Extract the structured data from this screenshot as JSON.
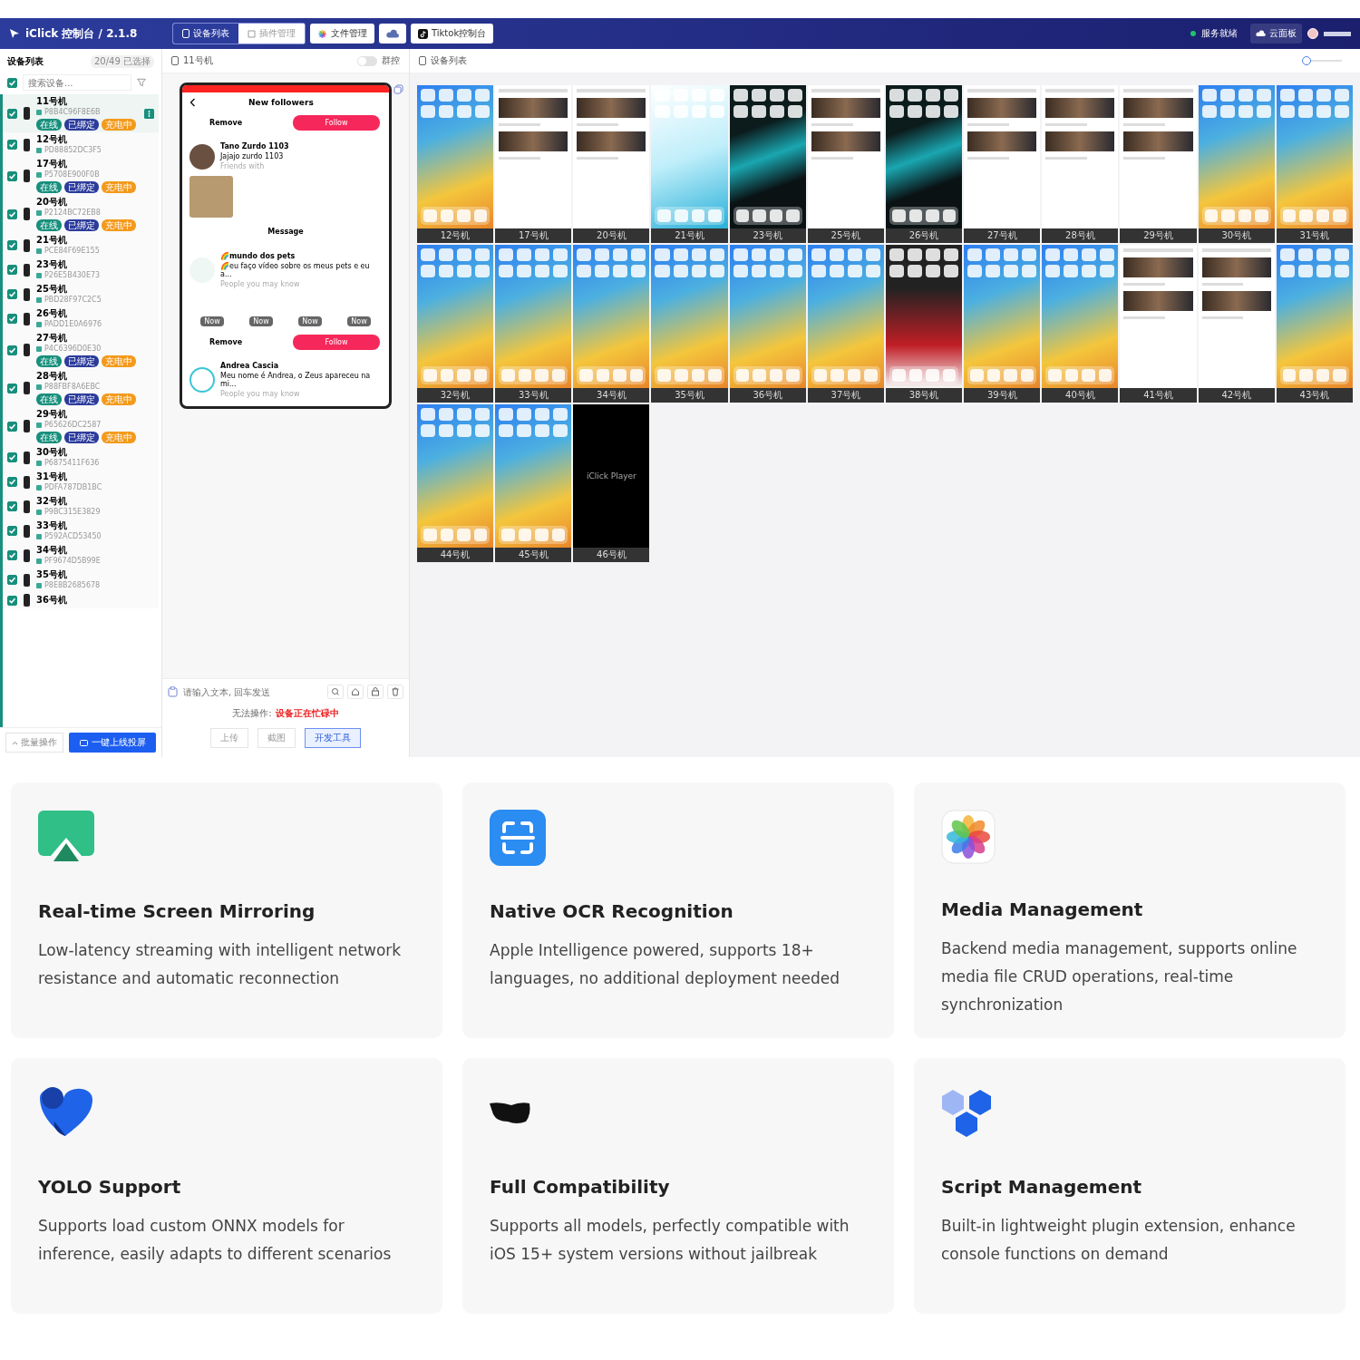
{
  "app": {
    "title": "iClick 控制台 / 2.1.8",
    "nav_tabs": [
      {
        "label": "设备列表",
        "selected": true
      },
      {
        "label": "插件管理",
        "selected": false
      }
    ],
    "nav_buttons": [
      {
        "label": "文件管理"
      },
      {
        "label": "Tiktok控制台"
      }
    ],
    "status": {
      "label": "服务就绪",
      "online": true
    },
    "cloud_button": "云面板"
  },
  "sidebar": {
    "title": "设备列表",
    "count": "20/49 已选择",
    "search_placeholder": "搜索设备...",
    "select_all": true,
    "devices": [
      {
        "name": "11号机",
        "serial": "P8B4C96F8E6B",
        "checked": true,
        "tags": [
          "在线",
          "已绑定",
          "充电中"
        ],
        "active": true
      },
      {
        "name": "12号机",
        "serial": "PD88852DC3F5",
        "checked": true,
        "active": false
      },
      {
        "name": "17号机",
        "serial": "P5708E900F0B",
        "checked": true,
        "tags": [
          "在线",
          "已绑定",
          "充电中"
        ],
        "active": false
      },
      {
        "name": "20号机",
        "serial": "P2124BC72EB8",
        "checked": true,
        "tags": [
          "在线",
          "已绑定",
          "充电中"
        ],
        "active": false
      },
      {
        "name": "21号机",
        "serial": "PCE84F69E155",
        "checked": true,
        "active": false
      },
      {
        "name": "23号机",
        "serial": "P26E5B430E73",
        "checked": true,
        "active": false
      },
      {
        "name": "25号机",
        "serial": "PBD28F97C2C5",
        "checked": true,
        "active": false
      },
      {
        "name": "26号机",
        "serial": "PADD1E0A6976",
        "checked": true,
        "active": false
      },
      {
        "name": "27号机",
        "serial": "P4C6396D0E30",
        "checked": true,
        "tags": [
          "在线",
          "已绑定",
          "充电中"
        ],
        "active": false
      },
      {
        "name": "28号机",
        "serial": "P88FBF8A6EBC",
        "checked": true,
        "tags": [
          "在线",
          "已绑定",
          "充电中"
        ],
        "active": false
      },
      {
        "name": "29号机",
        "serial": "P65626DC2587",
        "checked": true,
        "tags": [
          "在线",
          "已绑定",
          "充电中"
        ],
        "active": false
      },
      {
        "name": "30号机",
        "serial": "P6875411F636",
        "checked": true,
        "active": false
      },
      {
        "name": "31号机",
        "serial": "PDFA787DB1BC",
        "checked": true,
        "active": false
      },
      {
        "name": "32号机",
        "serial": "P9BC315E3829",
        "checked": true,
        "active": false
      },
      {
        "name": "33号机",
        "serial": "P592ACD53450",
        "checked": true,
        "active": false
      },
      {
        "name": "34号机",
        "serial": "PF9674D5B99E",
        "checked": true,
        "active": false
      },
      {
        "name": "35号机",
        "serial": "P8E8B2685678",
        "checked": true,
        "active": false
      },
      {
        "name": "36号机",
        "checked": true,
        "active": false
      }
    ],
    "batch_button": "批量操作",
    "cast_button": "一键上线投屏"
  },
  "control_panel": {
    "device": "11号机",
    "group_control": {
      "label": "群控",
      "on": false
    },
    "phone": {
      "title": "New followers",
      "remove": "Remove",
      "follow": "Follow",
      "users": [
        {
          "name": "Tano Zurdo 1103",
          "handle": "Jajajo zurdo 1103",
          "note": "Friends with"
        },
        {
          "name": "🌈mundo dos pets",
          "handle": "🌈eu faço vídeo sobre os meus pets e eu a...",
          "note": "People you may know"
        }
      ],
      "message": "Message",
      "chips": [
        "Now",
        "Now",
        "Now",
        "Now"
      ],
      "remove2": "Remove",
      "follow2": "Follow",
      "last_user": {
        "name": "Andrea Cascia",
        "handle": "Meu nome é Andrea, o Zeus apareceu na mi...",
        "note": "People you may know"
      }
    },
    "text_placeholder": "请输入文本, 回车发送",
    "notice_label": "无法操作:",
    "notice_value": "设备正在忙碌中",
    "tools": [
      {
        "label": "上传",
        "selected": false
      },
      {
        "label": "截图",
        "selected": false
      },
      {
        "label": "开发工具",
        "selected": true
      }
    ]
  },
  "grid": {
    "title": "设备列表",
    "zoom": {
      "level": 0.0
    },
    "screens": [
      {
        "label": "12号机",
        "kind": "home"
      },
      {
        "label": "17号机",
        "kind": "feed"
      },
      {
        "label": "20号机",
        "kind": "feed"
      },
      {
        "label": "21号机",
        "kind": "cyan"
      },
      {
        "label": "23号机",
        "kind": "dark"
      },
      {
        "label": "25号机",
        "kind": "feed"
      },
      {
        "label": "26号机",
        "kind": "dark"
      },
      {
        "label": "27号机",
        "kind": "feed"
      },
      {
        "label": "28号机",
        "kind": "feed"
      },
      {
        "label": "29号机",
        "kind": "feed"
      },
      {
        "label": "30号机",
        "kind": "home"
      },
      {
        "label": "31号机",
        "kind": "home"
      },
      {
        "label": "32号机",
        "kind": "home"
      },
      {
        "label": "33号机",
        "kind": "home"
      },
      {
        "label": "34号机",
        "kind": "home"
      },
      {
        "label": "35号机",
        "kind": "home"
      },
      {
        "label": "36号机",
        "kind": "home"
      },
      {
        "label": "37号机",
        "kind": "home"
      },
      {
        "label": "38号机",
        "kind": "red"
      },
      {
        "label": "39号机",
        "kind": "home"
      },
      {
        "label": "40号机",
        "kind": "home"
      },
      {
        "label": "41号机",
        "kind": "feed"
      },
      {
        "label": "42号机",
        "kind": "feed"
      },
      {
        "label": "43号机",
        "kind": "home"
      },
      {
        "label": "44号机",
        "kind": "home"
      },
      {
        "label": "45号机",
        "kind": "home"
      },
      {
        "label": "46号机",
        "kind": "player",
        "text": "iClick Player"
      }
    ]
  },
  "features": [
    {
      "title": "Real-time Screen Mirroring",
      "text": "Low-latency streaming with intelligent network resistance and automatic reconnection"
    },
    {
      "title": "Native OCR Recognition",
      "text": "Apple Intelligence powered, supports 18+ languages, no additional deployment needed"
    },
    {
      "title": "Media Management",
      "text": "Backend media management, supports online media file CRUD operations, real-time synchronization"
    },
    {
      "title": "YOLO Support",
      "text": "Supports load custom ONNX models for inference, easily adapts to different scenarios"
    },
    {
      "title": "Full Compatibility",
      "text": "Supports all models, perfectly compatible with iOS 15+ system versions without jailbreak"
    },
    {
      "title": "Script Management",
      "text": "Built-in lightweight plugin extension, enhance console functions on demand"
    }
  ]
}
